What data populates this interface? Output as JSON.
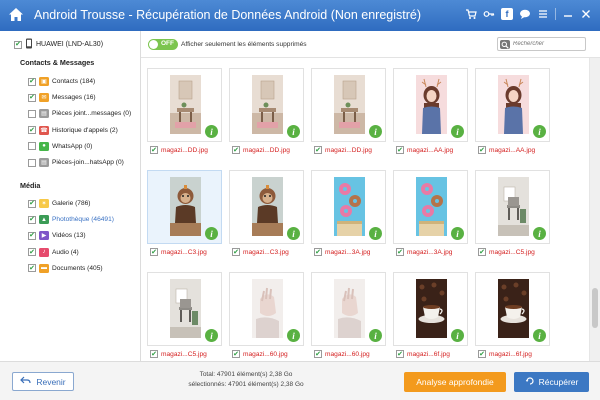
{
  "app": {
    "title": "Android Trousse - Récupération de Données Android (Non enregistré)"
  },
  "titlebar_icons": [
    "home-icon",
    "cart-icon",
    "key-icon",
    "facebook-icon",
    "chat-icon",
    "menu-icon",
    "minimize-icon",
    "close-icon"
  ],
  "device": {
    "name": "HUAWEI (LND-AL30)",
    "checked": true
  },
  "sidebar": {
    "section_contacts": "Contacts & Messages",
    "section_media": "Média",
    "contacts_items": [
      {
        "label": "Contacts (184)",
        "icon": "contacts-icon",
        "color": "#f0a127",
        "checked": true
      },
      {
        "label": "Messages (16)",
        "icon": "messages-icon",
        "color": "#f0a127",
        "checked": true
      },
      {
        "label": "Pièces joint...messages (0)",
        "icon": "attachment-icon",
        "color": "#9b9b9b",
        "checked": false
      },
      {
        "label": "Historique d'appels (2)",
        "icon": "call-history-icon",
        "color": "#e0564e",
        "checked": true
      },
      {
        "label": "WhatsApp (0)",
        "icon": "whatsapp-icon",
        "color": "#45b649",
        "checked": false
      },
      {
        "label": "Pièces-join...hatsApp (0)",
        "icon": "whatsapp-attachment-icon",
        "color": "#9b9b9b",
        "checked": false
      }
    ],
    "media_items": [
      {
        "label": "Galerie (786)",
        "icon": "gallery-icon",
        "color": "#f7c948",
        "checked": true,
        "selected": false
      },
      {
        "label": "Photothèque (46491)",
        "icon": "photo-library-icon",
        "color": "#3b9c56",
        "checked": true,
        "selected": true
      },
      {
        "label": "Vidéos (13)",
        "icon": "video-icon",
        "color": "#7f56c8",
        "checked": true,
        "selected": false
      },
      {
        "label": "Audio (4)",
        "icon": "audio-icon",
        "color": "#e64b6d",
        "checked": true,
        "selected": false
      },
      {
        "label": "Documents (405)",
        "icon": "documents-icon",
        "color": "#f0a127",
        "checked": true,
        "selected": false
      }
    ]
  },
  "filter": {
    "toggle_label": "OFF",
    "toggle_state": "off",
    "label": "Afficher seulement les éléments supprimés",
    "search_placeholder": "Rechercher"
  },
  "thumbnails": [
    {
      "name": "magazi...DD.jpg",
      "type": "room",
      "checked": true,
      "selected": false
    },
    {
      "name": "magazi...DD.jpg",
      "type": "room",
      "checked": true,
      "selected": false
    },
    {
      "name": "magazi...DD.jpg",
      "type": "room",
      "checked": true,
      "selected": false
    },
    {
      "name": "magazi...AA.jpg",
      "type": "girl",
      "checked": true,
      "selected": false
    },
    {
      "name": "magazi...AA.jpg",
      "type": "girl",
      "checked": true,
      "selected": false
    },
    {
      "name": "magazi...C3.jpg",
      "type": "monkey",
      "checked": true,
      "selected": true
    },
    {
      "name": "magazi...C3.jpg",
      "type": "monkey",
      "checked": true,
      "selected": false
    },
    {
      "name": "magazi...3A.jpg",
      "type": "donut",
      "checked": true,
      "selected": false
    },
    {
      "name": "magazi...3A.jpg",
      "type": "donut",
      "checked": true,
      "selected": false
    },
    {
      "name": "magazi...C5.jpg",
      "type": "chair",
      "checked": true,
      "selected": false
    },
    {
      "name": "magazi...C5.jpg",
      "type": "chair",
      "checked": true,
      "selected": false
    },
    {
      "name": "magazi...60.jpg",
      "type": "hand",
      "checked": true,
      "selected": false
    },
    {
      "name": "magazi...60.jpg",
      "type": "hand",
      "checked": true,
      "selected": false
    },
    {
      "name": "magazi...6f.jpg",
      "type": "coffee",
      "checked": true,
      "selected": false
    },
    {
      "name": "magazi...6f.jpg",
      "type": "coffee",
      "checked": true,
      "selected": false
    }
  ],
  "footer": {
    "back_label": "Revenir",
    "total_text": "Total: 47901 élément(s) 2,38 Go",
    "selected_text": "sélectionnés: 47901 élément(s) 2,38 Go",
    "deep_scan_label": "Analyse approfondie",
    "recover_label": "Récupérer"
  },
  "colors": {
    "titlebar": "#3a78c8",
    "accent_orange": "#f39a1d",
    "accent_blue": "#3c78c3",
    "toggle_green": "#7cc54f",
    "info_green": "#59b142",
    "filename_red": "#d42020"
  }
}
